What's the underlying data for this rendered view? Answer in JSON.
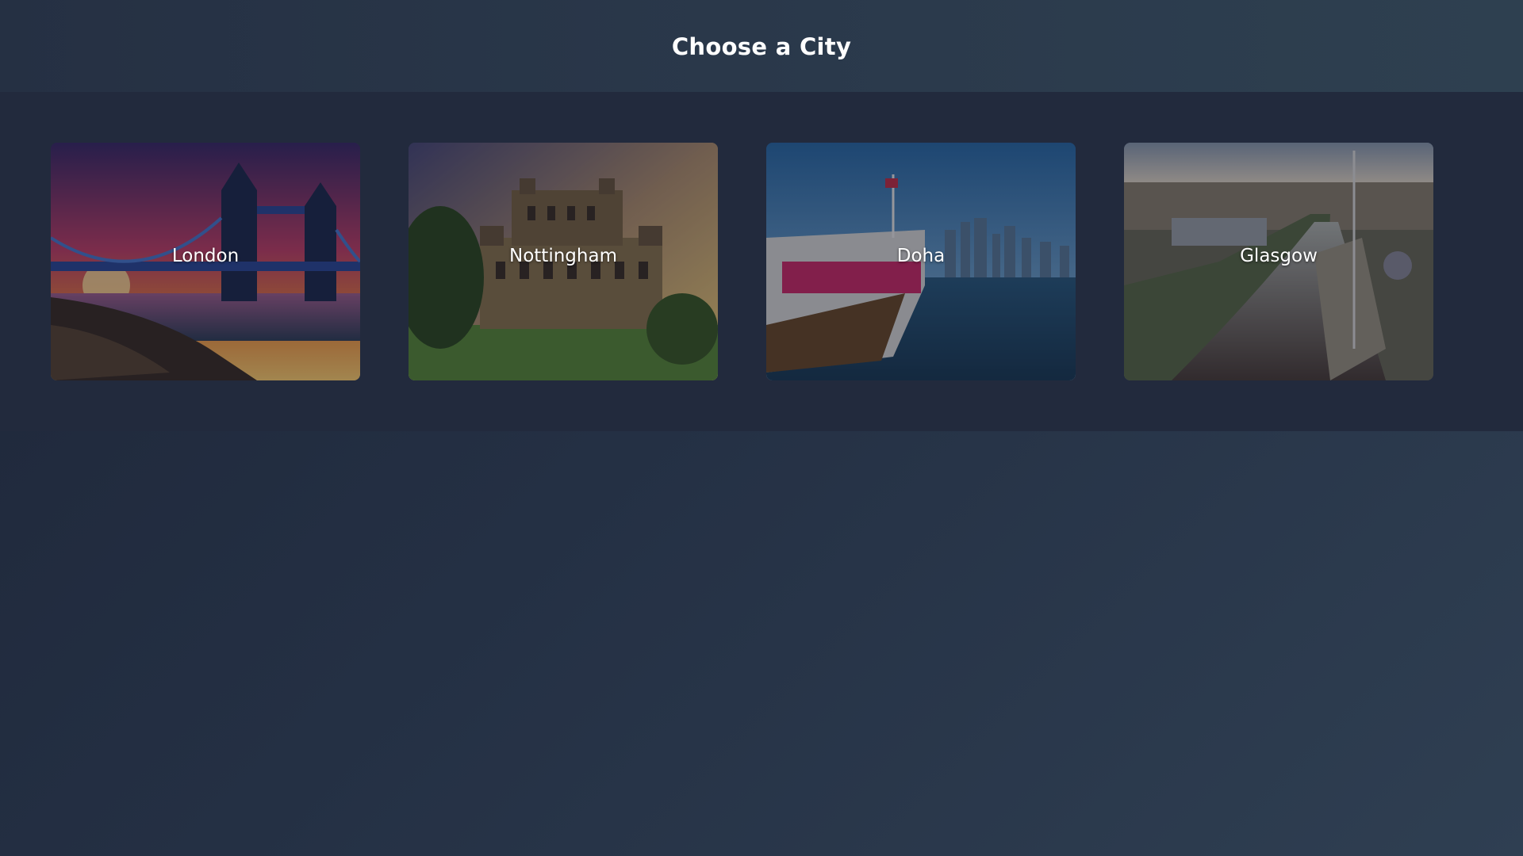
{
  "header": {
    "title": "Choose a City"
  },
  "cities": [
    {
      "label": "London"
    },
    {
      "label": "Nottingham"
    },
    {
      "label": "Doha"
    },
    {
      "label": "Glasgow"
    }
  ]
}
